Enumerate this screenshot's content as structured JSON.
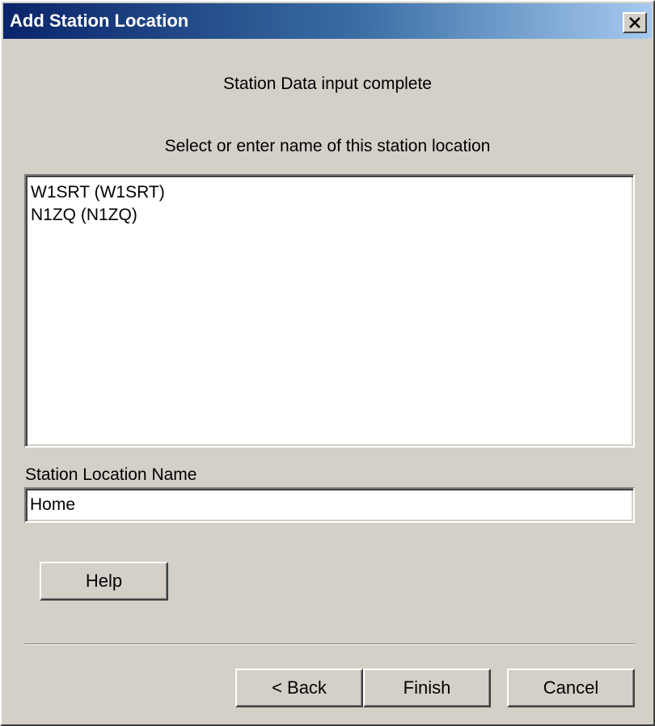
{
  "window": {
    "title": "Add Station Location",
    "close_icon": "close-icon"
  },
  "content": {
    "status_text": "Station Data input complete",
    "instruction_text": "Select or enter name of this station location",
    "station_list": [
      "W1SRT (W1SRT)",
      "N1ZQ (N1ZQ)"
    ],
    "location_label": "Station Location Name",
    "location_value": "Home"
  },
  "buttons": {
    "help": "Help",
    "back": "< Back",
    "finish": "Finish",
    "cancel": "Cancel"
  },
  "colors": {
    "titlebar_start": "#0a246a",
    "titlebar_end": "#a6caf0",
    "face": "#d4d0c8"
  }
}
